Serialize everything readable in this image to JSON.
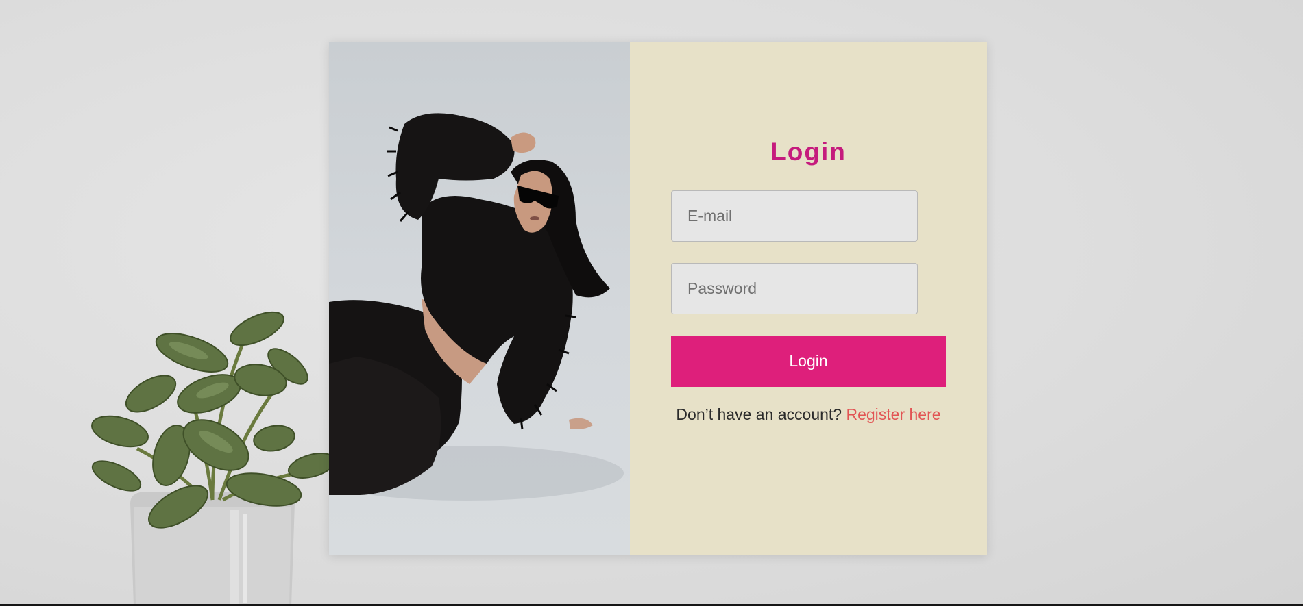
{
  "login": {
    "title": "Login",
    "email_placeholder": "E-mail",
    "password_placeholder": "Password",
    "button_label": "Login",
    "prompt_text": "Don’t have an account?",
    "register_link": "Register here"
  },
  "colors": {
    "title": "#c51b7d",
    "button": "#de1f7b",
    "link": "#e25454",
    "panel": "#e7e1c8",
    "page_background": "#dddddd"
  },
  "icons": [
    "plant-image",
    "model-photo"
  ]
}
